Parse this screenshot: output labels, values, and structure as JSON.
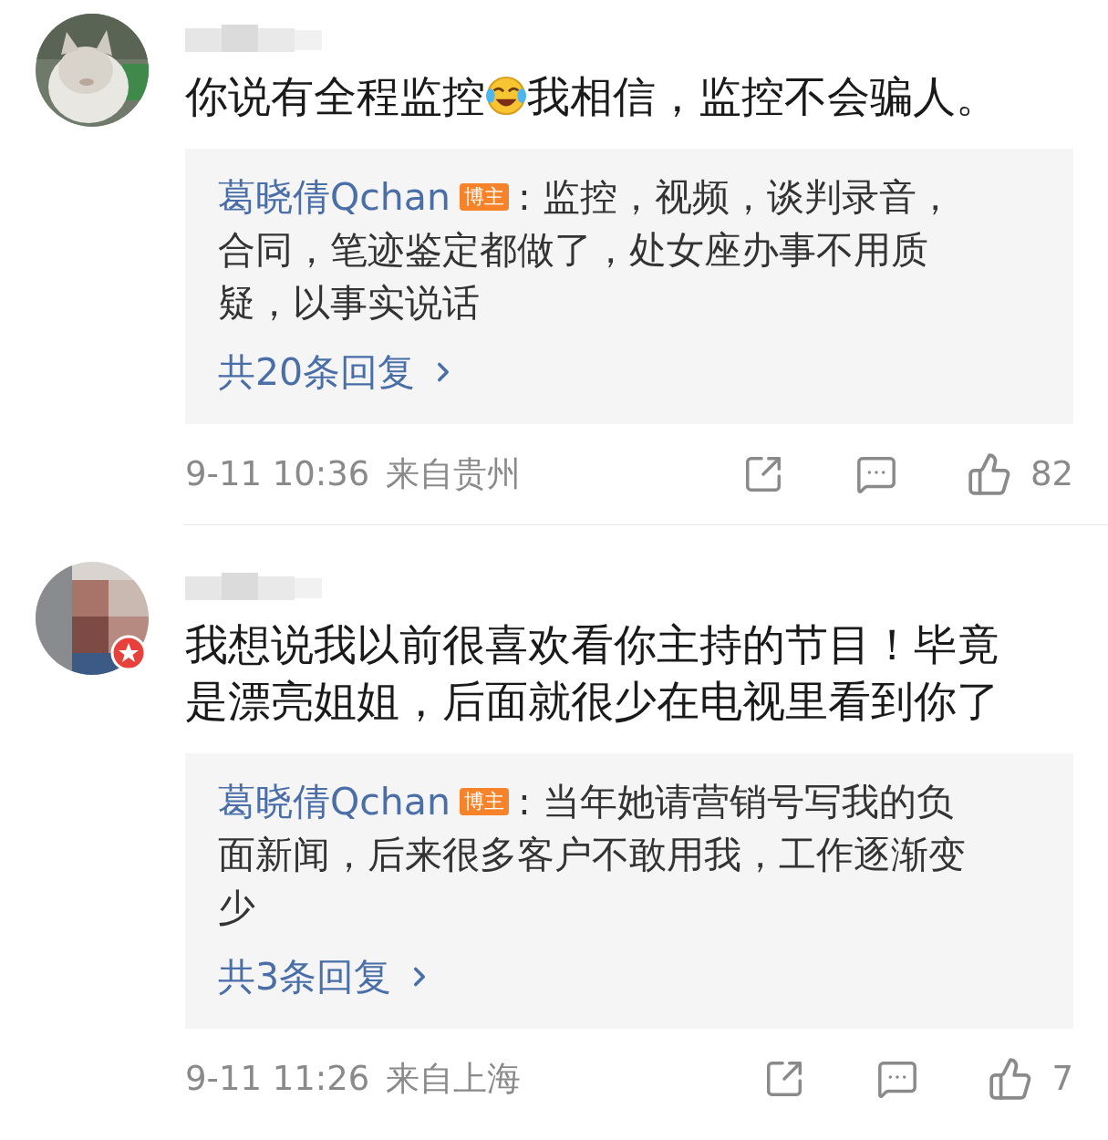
{
  "comments": [
    {
      "avatar": {
        "verified": false
      },
      "content": [
        {
          "kind": "text",
          "text": "你说有全程监控"
        },
        {
          "kind": "emoji"
        },
        {
          "kind": "text",
          "text": "我相信，监控不会骗人。"
        }
      ],
      "reply": {
        "author": "葛晓倩Qchan",
        "badge": "博主",
        "separator": ":",
        "text": "监控，视频，谈判录音，合同，笔迹鉴定都做了，处女座办事不用质疑，以事实说话",
        "more": "共20条回复"
      },
      "time": "9-11 10:36",
      "location": "来自贵州",
      "likes": "82"
    },
    {
      "avatar": {
        "verified": true
      },
      "content": [
        {
          "kind": "text",
          "text": "我想说我以前很喜欢看你主持的节目！毕竟是漂亮姐姐，后面就很少在电视里看到你了"
        }
      ],
      "reply": {
        "author": "葛晓倩Qchan",
        "badge": "博主",
        "separator": ":",
        "text": "当年她请营销号写我的负面新闻，后来很多客户不敢用我，工作逐渐变少",
        "more": "共3条回复"
      },
      "time": "9-11 11:26",
      "location": "来自上海",
      "likes": "7"
    }
  ]
}
